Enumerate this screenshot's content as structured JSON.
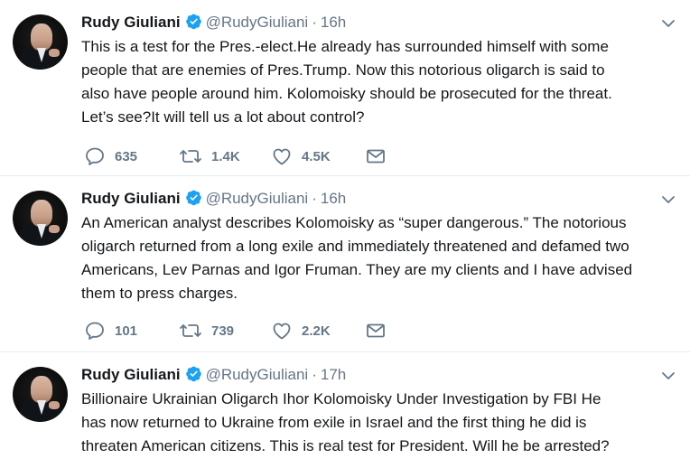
{
  "tweets": [
    {
      "name": "Rudy Giuliani",
      "handle": "@RudyGiuliani",
      "time": "16h",
      "text": "This is a test for the Pres.-elect.He already has surrounded himself with some\npeople that are enemies of Pres.Trump. Now this notorious oligarch is said to\nalso have people around him. Kolomoisky should be prosecuted for the threat.\nLet’s see?It will tell us a lot about control?",
      "replies": "635",
      "retweets": "1.4K",
      "likes": "4.5K"
    },
    {
      "name": "Rudy Giuliani",
      "handle": "@RudyGiuliani",
      "time": "16h",
      "text": "An American analyst describes Kolomoisky as “super dangerous.” The notorious\noligarch returned from a long exile and immediately threatened and defamed two\nAmericans, Lev Parnas and Igor Fruman. They are my clients and I have advised\nthem to press charges.",
      "replies": "101",
      "retweets": "739",
      "likes": "2.2K"
    },
    {
      "name": "Rudy Giuliani",
      "handle": "@RudyGiuliani",
      "time": "17h",
      "text": "Billionaire Ukrainian Oligarch Ihor Kolomoisky Under Investigation by FBI    He\nhas now returned to Ukraine from exile in Israel  and the first thing he did is\nthreaten American citizens. This is real test for President. Will he be arrested?",
      "replies": "",
      "retweets": "",
      "likes": ""
    }
  ],
  "colors": {
    "text": "#14171a",
    "secondary": "#657786",
    "verified": "#1da1f2",
    "divider": "#e6ecf0"
  },
  "icons": [
    "verified-badge-icon",
    "chevron-down-icon",
    "reply-icon",
    "retweet-icon",
    "like-icon",
    "direct-message-icon"
  ]
}
